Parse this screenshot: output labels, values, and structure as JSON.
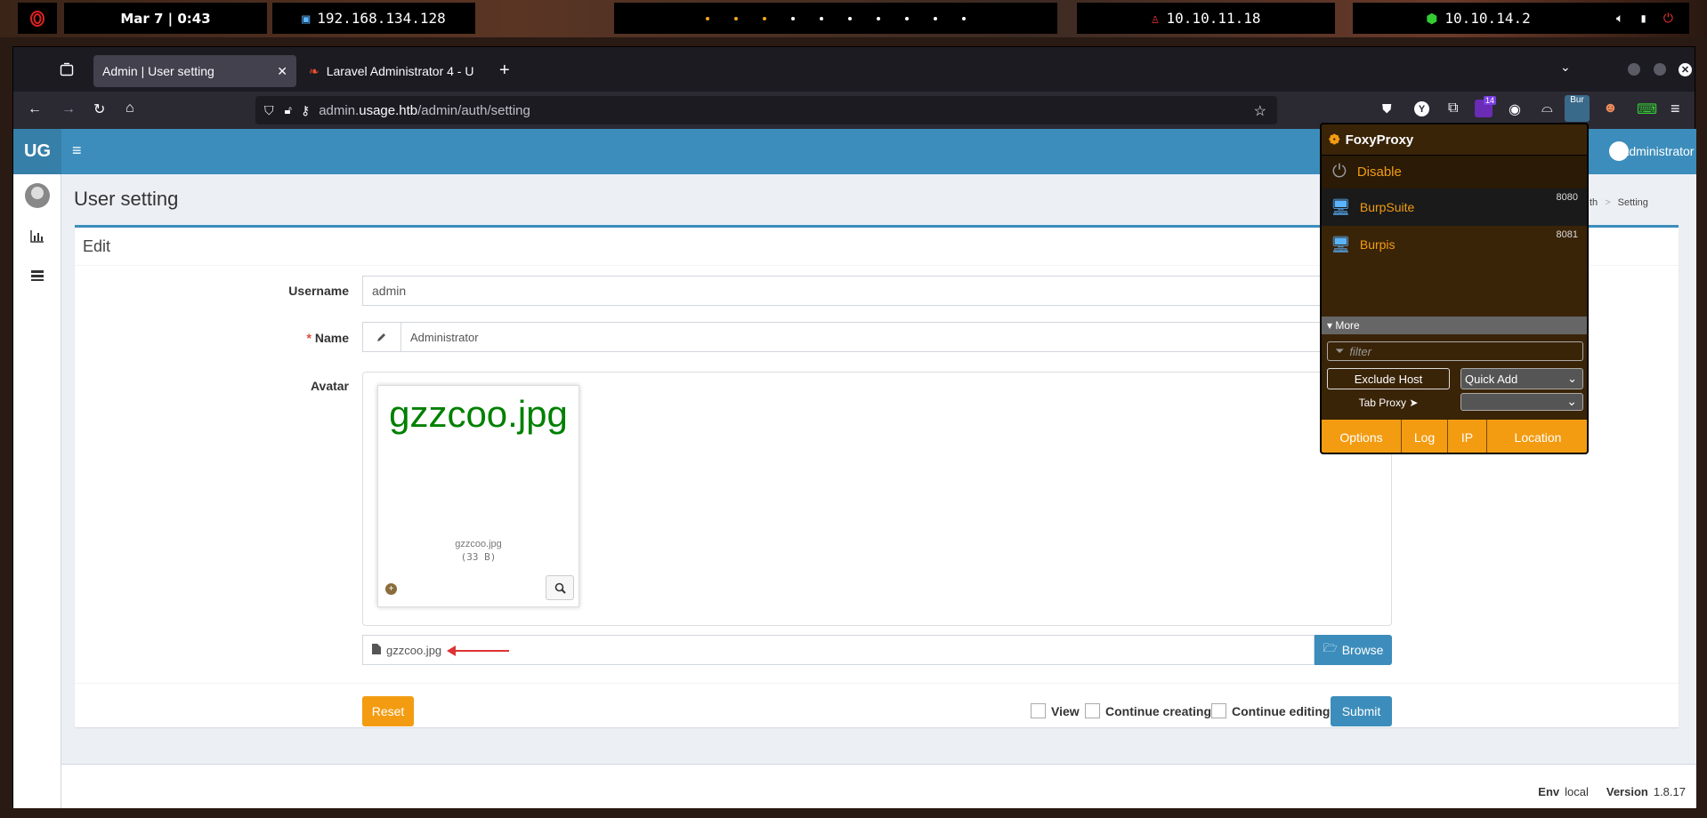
{
  "desktop": {
    "datetime": "Mar 7 | 0:43",
    "vpn_ip": "192.168.134.128",
    "target_ip": "10.10.11.18",
    "tun_ip": "10.10.14.2"
  },
  "browser": {
    "tabs": [
      {
        "label": "Admin | User setting"
      },
      {
        "label": "Laravel Administrator 4 - U"
      }
    ],
    "url_host": "admin.usage.htb",
    "url_prefix": "admin.",
    "url_domain": "usage.htb",
    "url_path": "/admin/auth/setting",
    "ext_badge": "14",
    "burp_label": "Bur"
  },
  "app": {
    "logo": "UG",
    "user_name": "Administrator",
    "page_title": "User setting",
    "breadcrumb": [
      "th",
      ">",
      "Setting"
    ],
    "box_title": "Edit",
    "form": {
      "username_label": "Username",
      "username_value": "admin",
      "name_required": "*",
      "name_label": "Name",
      "name_value": "Administrator",
      "avatar_label": "Avatar",
      "preview_caption": "gzzcoo.jpg",
      "preview_filename": "gzzcoo.jpg",
      "preview_size": "(33 B)",
      "file_value": "gzzcoo.jpg",
      "browse_label": "Browse"
    },
    "footer_buttons": {
      "reset": "Reset",
      "view": "View",
      "continue_creating": "Continue creating",
      "continue_editing": "Continue editing",
      "submit": "Submit"
    },
    "footer": {
      "env_label": "Env",
      "env_value": "local",
      "version_label": "Version",
      "version_value": "1.8.17"
    }
  },
  "foxyproxy": {
    "title": "FoxyProxy",
    "disable": "Disable",
    "proxies": [
      {
        "name": "BurpSuite",
        "port": "8080"
      },
      {
        "name": "Burpis",
        "port": "8081"
      }
    ],
    "more": "▾ More",
    "filter_placeholder": "filter",
    "exclude_host": "Exclude Host",
    "quick_add": "Quick Add",
    "tab_proxy": "Tab Proxy ➤",
    "buttons": [
      "Options",
      "Log",
      "IP",
      "Location"
    ]
  },
  "colors": {
    "header_blue": "#3c8dbc",
    "fp_orange": "#f39c12",
    "preview_green": "#008000"
  }
}
